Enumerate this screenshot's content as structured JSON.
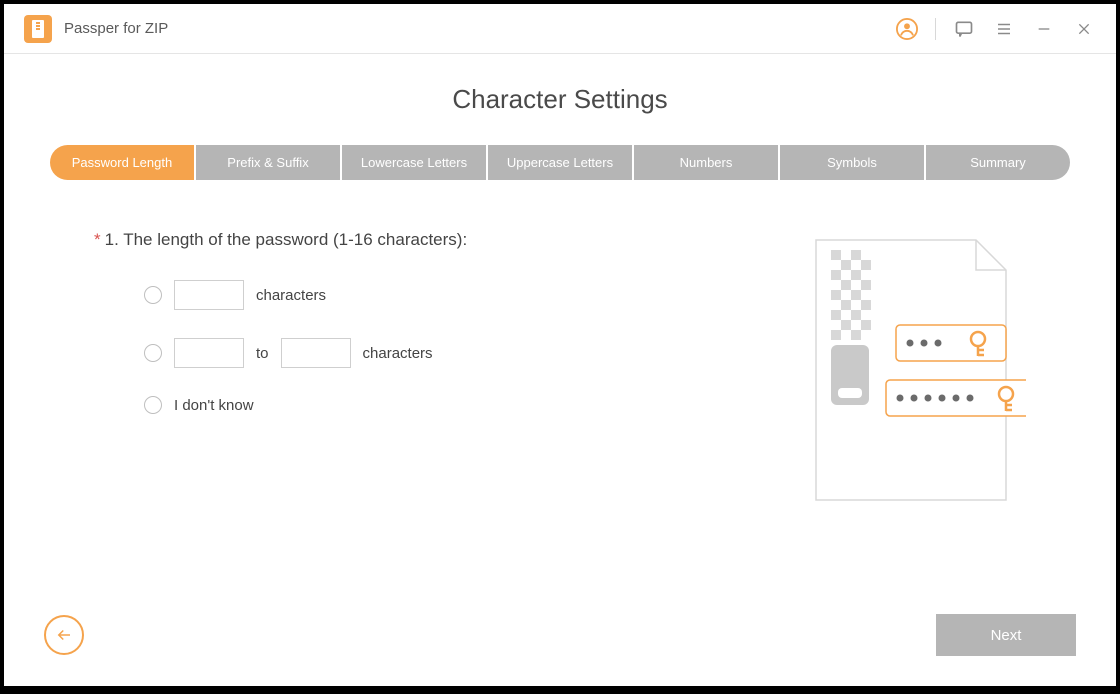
{
  "app": {
    "title": "Passper for ZIP"
  },
  "page": {
    "title": "Character Settings"
  },
  "tabs": [
    {
      "label": "Password Length",
      "active": true
    },
    {
      "label": "Prefix & Suffix",
      "active": false
    },
    {
      "label": "Lowercase Letters",
      "active": false
    },
    {
      "label": "Uppercase Letters",
      "active": false
    },
    {
      "label": "Numbers",
      "active": false
    },
    {
      "label": "Symbols",
      "active": false
    },
    {
      "label": "Summary",
      "active": false
    }
  ],
  "question": {
    "required_mark": "*",
    "text": "1. The length of the password (1-16 characters):"
  },
  "options": {
    "exact": {
      "suffix": "characters",
      "value": ""
    },
    "range": {
      "middle": "to",
      "suffix": "characters",
      "from": "",
      "to": ""
    },
    "unknown": {
      "label": "I don't know"
    }
  },
  "footer": {
    "next": "Next"
  }
}
